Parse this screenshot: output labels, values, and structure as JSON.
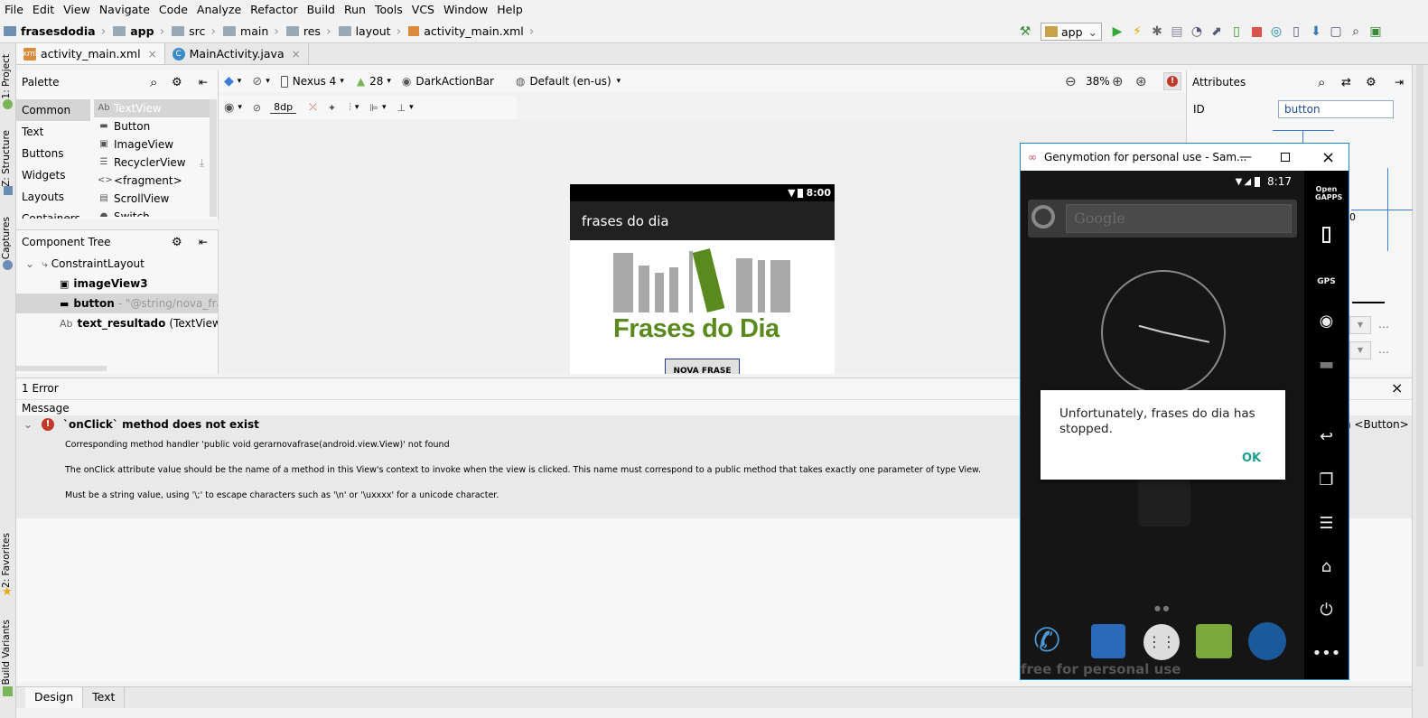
{
  "menu": [
    "File",
    "Edit",
    "View",
    "Navigate",
    "Code",
    "Analyze",
    "Refactor",
    "Build",
    "Run",
    "Tools",
    "VCS",
    "Window",
    "Help"
  ],
  "breadcrumb": [
    "frasesdodia",
    "app",
    "src",
    "main",
    "res",
    "layout",
    "activity_main.xml"
  ],
  "run_config": "app",
  "editor_tabs": [
    {
      "label": "activity_main.xml",
      "active": true
    },
    {
      "label": "MainActivity.java",
      "active": false
    }
  ],
  "left_strip": {
    "project": "1: Project",
    "structure": "Z: Structure",
    "captures": "Captures",
    "favorites": "2: Favorites",
    "build_variants": "Build Variants"
  },
  "palette": {
    "title": "Palette",
    "categories": [
      "Common",
      "Text",
      "Buttons",
      "Widgets",
      "Layouts",
      "Containers"
    ],
    "items": [
      {
        "icon": "Ab",
        "label": "TextView"
      },
      {
        "icon": "▬",
        "label": "Button"
      },
      {
        "icon": "▣",
        "label": "ImageView"
      },
      {
        "icon": "☰",
        "label": "RecyclerView"
      },
      {
        "icon": "<>",
        "label": "<fragment>"
      },
      {
        "icon": "▤",
        "label": "ScrollView"
      },
      {
        "icon": "●",
        "label": "Switch"
      }
    ]
  },
  "component_tree": {
    "title": "Component Tree",
    "root": "ConstraintLayout",
    "rows": [
      {
        "icon": "▣",
        "name": "imageView3",
        "detail": ""
      },
      {
        "icon": "▬",
        "name": "button",
        "detail": "- \"@string/nova_frase\""
      },
      {
        "icon": "Ab",
        "name": "text_resultado",
        "detail": "(TextView) - \"@"
      }
    ]
  },
  "design_toolbar": {
    "device": "Nexus 4",
    "api": "28",
    "theme": "DarkActionBar",
    "locale": "Default (en-us)",
    "zoom": "38%",
    "margin": "8dp"
  },
  "preview": {
    "status_time": "8:00",
    "app_title": "frases do dia",
    "logo_text": "Frases do Dia",
    "button_text": "NOVA FRASE"
  },
  "attributes": {
    "title": "Attributes",
    "id_label": "ID",
    "id_value": "button",
    "partial_text": "n <Button>",
    "zero": "0"
  },
  "messages": {
    "header": "1 Error",
    "column": "Message",
    "error_title": "`onClick` method does not exist",
    "lines": [
      "Corresponding method handler 'public void gerarnovafrase(android.view.View)' not found",
      "The onClick attribute value should be the name of a method in this View's context to invoke when the view is clicked. This name must correspond to a public method that takes exactly one parameter of type View.",
      "Must be a string value, using '\\;' to escape characters such as '\\n' or '\\uxxxx' for a unicode character."
    ]
  },
  "bottom_tabs": [
    "Design",
    "Text"
  ],
  "genymotion": {
    "window_title": "Genymotion for personal use - Sam...",
    "status_time": "8:17",
    "search_placeholder": "Google",
    "dialog_message": "Unfortunately, frases do dia has stopped.",
    "dialog_ok": "OK",
    "watermark": "free for personal use",
    "side_labels": [
      "Open GAPPS",
      "GPS"
    ]
  },
  "colors": {
    "accent": "#1a84c8",
    "error": "#c0392b",
    "logo_green": "#5a8a1e",
    "logo_gray": "#a8a8a8",
    "dialog_ok": "#1e9e8e"
  }
}
